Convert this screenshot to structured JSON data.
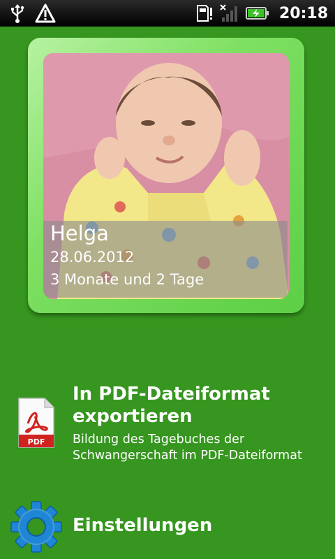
{
  "status_bar": {
    "time": "20:18",
    "icons": [
      "usb-icon",
      "warning-icon",
      "sdcard-icon",
      "no-signal-icon",
      "battery-charging-icon"
    ]
  },
  "profile": {
    "name": "Helga",
    "birth_date": "28.06.2012",
    "age": "3 Monate und 2 Tage"
  },
  "menu": {
    "export": {
      "title": "In PDF-Dateiformat exportieren",
      "description": "Bildung des Tagebuches der Schwangerschaft im PDF-Dateiformat",
      "icon": "pdf-file-icon",
      "icon_label": "PDF"
    },
    "settings": {
      "title": "Einstellungen",
      "icon": "gear-icon"
    }
  },
  "colors": {
    "background": "#36961f",
    "frame": "#7ee062",
    "pdf_red": "#d0231f",
    "gear_blue": "#1f86d6"
  }
}
